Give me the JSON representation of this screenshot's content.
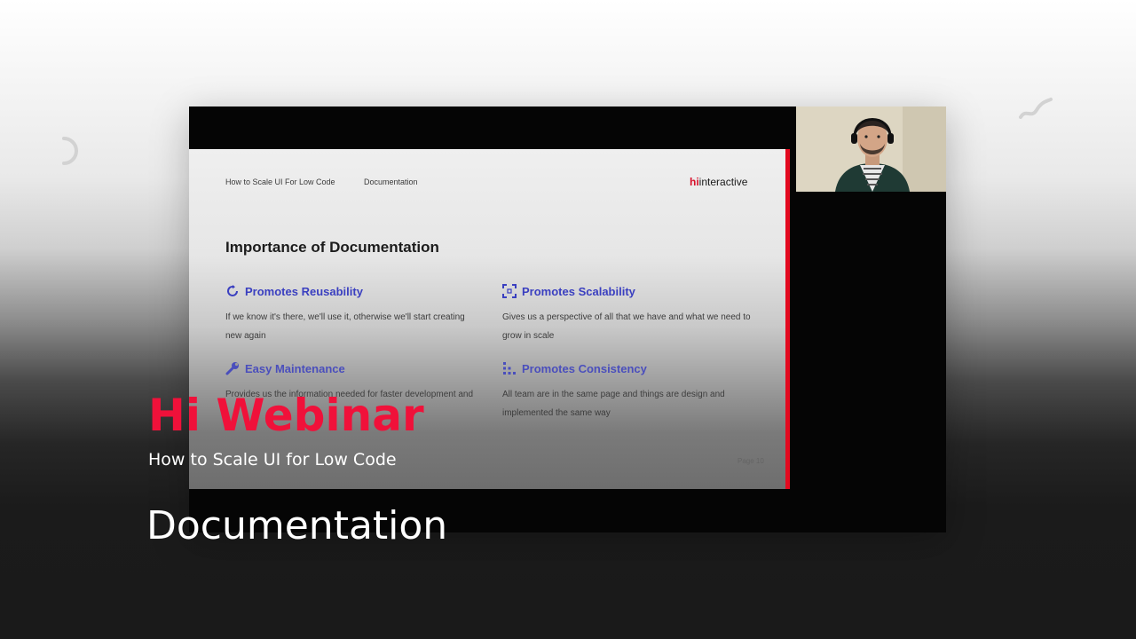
{
  "slide": {
    "breadcrumb": "How to Scale UI For Low Code",
    "section": "Documentation",
    "logo_hi": "hi",
    "logo_text": "interactive",
    "title": "Importance of Documentation",
    "features": [
      {
        "heading": "Promotes Reusability",
        "description": "If we know it's there, we'll use it, otherwise we'll start creating new again",
        "icon": "circular-arrow-icon"
      },
      {
        "heading": "Promotes Scalability",
        "description": "Gives us a perspective of all that we have and what we need to grow in scale",
        "icon": "expand-corners-icon"
      },
      {
        "heading": "Easy Maintenance",
        "description": "Provides us the information needed for faster development and",
        "icon": "wrench-icon"
      },
      {
        "heading": "Promotes Consistency",
        "description": "All team are in the same page and things are design and implemented the same way",
        "icon": "grid-dots-icon"
      }
    ],
    "page_number": "Page 10"
  },
  "overlay": {
    "title": "Hi Webinar",
    "subtitle": "How to Scale UI for Low Code",
    "section": "Documentation"
  },
  "colors": {
    "brand_red": "#f0113a",
    "slide_accent_red": "#e3091f",
    "feature_blue": "#3a3fc0"
  }
}
